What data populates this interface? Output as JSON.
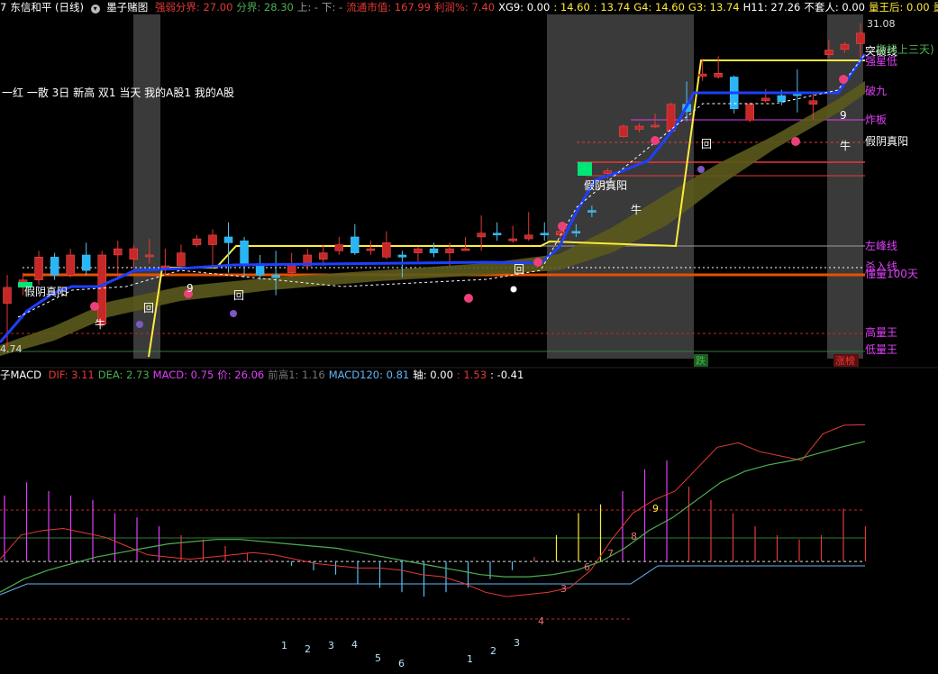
{
  "header": {
    "code": "7",
    "name": "东信和平 (日线)",
    "formula": "墨子赌图",
    "items": [
      {
        "label": "强弱分界:",
        "value": "27.00",
        "color": "#e53935"
      },
      {
        "label": "分界:",
        "value": "28.30",
        "color": "#4caf50"
      },
      {
        "label": "上:",
        "value": "-",
        "color": "#9e9e9e"
      },
      {
        "label": "下:",
        "value": "-",
        "color": "#9e9e9e"
      },
      {
        "label": "流通市值:",
        "value": "167.99",
        "color": "#e53935"
      },
      {
        "label": "利润%:",
        "value": "7.40",
        "color": "#e53935"
      },
      {
        "label": "XG9:",
        "value": "0.00",
        "color": "#ffffff"
      },
      {
        "label": ":",
        "value": "14.60",
        "color": "#ffeb3b"
      },
      {
        "label": ":",
        "value": "13.74",
        "color": "#ffeb3b"
      },
      {
        "label": "G4:",
        "value": "14.60",
        "color": "#ffeb3b"
      },
      {
        "label": "G3:",
        "value": "13.74",
        "color": "#ffeb3b"
      },
      {
        "label": "H11:",
        "value": "27.26",
        "color": "#ffffff"
      },
      {
        "label": "不套人:",
        "value": "0.00",
        "color": "#ffffff"
      },
      {
        "label": "量王后:",
        "value": "0.00",
        "color": "#ffeb3b"
      },
      {
        "label": "量",
        "value": "",
        "color": "#ffeb3b"
      }
    ]
  },
  "main_chart": {
    "price_high": "31.08",
    "price_low": "4.74",
    "legend_text": "一红 一散 3日 新高 双1 当天 我的A股1 我的A股",
    "right_labels": [
      {
        "text": "突破线",
        "color": "#ffffff"
      },
      {
        "text": "指标上三天)",
        "color": "#4caf50"
      },
      {
        "text": "强星低",
        "color": "#e040fb"
      },
      {
        "text": "破九",
        "color": "#e040fb"
      },
      {
        "text": "炸板",
        "color": "#e040fb"
      },
      {
        "text": "假阴真阳",
        "color": "#ffffff"
      },
      {
        "text": "左峰线",
        "color": "#e040fb"
      },
      {
        "text": "杀入线",
        "color": "#e040fb"
      },
      {
        "text": "懂量100天",
        "color": "#e040fb"
      },
      {
        "text": "高量王",
        "color": "#e040fb"
      },
      {
        "text": "低量王",
        "color": "#e040fb"
      }
    ],
    "annotations": [
      "假阴真阳",
      "假阴真阳",
      "回",
      "回",
      "回",
      "回",
      "牛",
      "牛",
      "牛",
      "9",
      "9",
      "9"
    ],
    "bottom_tags": [
      {
        "text": "跌",
        "color": "#4caf50"
      },
      {
        "text": "涨榜",
        "color": "#e53935"
      }
    ]
  },
  "macd_header": {
    "title": "子MACD",
    "items": [
      {
        "label": "DIF:",
        "value": "3.11",
        "color": "#e53935"
      },
      {
        "label": "DEA:",
        "value": "2.73",
        "color": "#4caf50"
      },
      {
        "label": "MACD:",
        "value": "0.75",
        "color": "#e040fb"
      },
      {
        "label": "价:",
        "value": "26.06",
        "color": "#e040fb"
      },
      {
        "label": "前高1:",
        "value": "1.16",
        "color": "#757575"
      },
      {
        "label": "MACD120:",
        "value": "0.81",
        "color": "#64b5f6"
      },
      {
        "label": "轴:",
        "value": "0.00",
        "color": "#ffffff"
      },
      {
        "label": ":",
        "value": "1.53",
        "color": "#e53935"
      },
      {
        "label": ":",
        "value": "-0.41",
        "color": "#ffffff"
      }
    ]
  },
  "macd_counts": {
    "up": [
      "3",
      "4",
      "5",
      "6",
      "7",
      "8",
      "9"
    ],
    "down": [
      "1",
      "2",
      "3",
      "4",
      "5",
      "6",
      "1",
      "2",
      "3"
    ]
  },
  "chart_data": {
    "type": "candlestick",
    "candles": [
      {
        "o": 6.3,
        "c": 6.9,
        "h": 7.4,
        "l": 4.9
      },
      {
        "o": 6.9,
        "c": 7.2,
        "h": 7.5,
        "l": 6.6
      },
      {
        "o": 7.2,
        "c": 8.2,
        "h": 8.5,
        "l": 7.0
      },
      {
        "o": 8.2,
        "c": 7.4,
        "h": 8.4,
        "l": 7.2
      },
      {
        "o": 7.4,
        "c": 8.3,
        "h": 8.6,
        "l": 7.3
      },
      {
        "o": 8.3,
        "c": 7.6,
        "h": 8.9,
        "l": 7.4
      },
      {
        "o": 5.6,
        "c": 8.3,
        "h": 8.5,
        "l": 5.5
      },
      {
        "o": 8.3,
        "c": 8.6,
        "h": 9.0,
        "l": 7.2
      },
      {
        "o": 8.1,
        "c": 8.6,
        "h": 8.8,
        "l": 7.7
      },
      {
        "o": 8.3,
        "c": 8.3,
        "h": 9.1,
        "l": 7.9
      },
      {
        "o": 7.8,
        "c": 7.8,
        "h": 8.6,
        "l": 7.4
      },
      {
        "o": 7.8,
        "c": 8.4,
        "h": 8.8,
        "l": 7.8
      },
      {
        "o": 8.8,
        "c": 9.1,
        "h": 9.3,
        "l": 8.7
      },
      {
        "o": 8.8,
        "c": 9.3,
        "h": 9.6,
        "l": 7.7
      },
      {
        "o": 9.2,
        "c": 8.9,
        "h": 10.0,
        "l": 7.5
      },
      {
        "o": 9.0,
        "c": 7.8,
        "h": 9.2,
        "l": 7.3
      },
      {
        "o": 7.9,
        "c": 7.4,
        "h": 8.3,
        "l": 7.2
      },
      {
        "o": 7.4,
        "c": 7.3,
        "h": 8.5,
        "l": 6.6
      },
      {
        "o": 7.5,
        "c": 7.9,
        "h": 8.4,
        "l": 7.3
      },
      {
        "o": 7.8,
        "c": 8.3,
        "h": 8.6,
        "l": 7.6
      },
      {
        "o": 8.1,
        "c": 8.4,
        "h": 8.8,
        "l": 7.8
      },
      {
        "o": 8.5,
        "c": 8.8,
        "h": 9.2,
        "l": 8.3
      },
      {
        "o": 9.2,
        "c": 8.4,
        "h": 9.9,
        "l": 8.3
      },
      {
        "o": 8.6,
        "c": 8.6,
        "h": 9.0,
        "l": 8.3
      },
      {
        "o": 8.2,
        "c": 8.9,
        "h": 9.5,
        "l": 8.1
      },
      {
        "o": 8.3,
        "c": 8.2,
        "h": 8.5,
        "l": 7.3
      },
      {
        "o": 8.4,
        "c": 8.6,
        "h": 8.7,
        "l": 8.0
      },
      {
        "o": 8.6,
        "c": 8.4,
        "h": 8.9,
        "l": 8.2
      },
      {
        "o": 8.4,
        "c": 8.6,
        "h": 8.9,
        "l": 7.8
      },
      {
        "o": 8.6,
        "c": 8.6,
        "h": 9.2,
        "l": 8.5
      },
      {
        "o": 9.2,
        "c": 9.4,
        "h": 10.4,
        "l": 8.5
      },
      {
        "o": 9.4,
        "c": 9.3,
        "h": 10.0,
        "l": 9.0
      },
      {
        "o": 9.0,
        "c": 9.1,
        "h": 9.8,
        "l": 8.9
      },
      {
        "o": 9.1,
        "c": 9.3,
        "h": 10.6,
        "l": 9.0
      },
      {
        "o": 9.4,
        "c": 9.3,
        "h": 10.0,
        "l": 9.0
      },
      {
        "o": 9.3,
        "c": 9.5,
        "h": 9.8,
        "l": 9.1
      },
      {
        "o": 9.5,
        "c": 9.4,
        "h": 9.9,
        "l": 9.2
      },
      {
        "o": 10.7,
        "c": 10.6,
        "h": 11.0,
        "l": 10.3
      },
      {
        "o": 13.2,
        "c": 13.4,
        "h": 13.6,
        "l": 12.8
      },
      {
        "o": 16.3,
        "c": 17.3,
        "h": 17.5,
        "l": 16.2
      },
      {
        "o": 17.0,
        "c": 17.3,
        "h": 17.6,
        "l": 16.7
      },
      {
        "o": 17.3,
        "c": 17.4,
        "h": 18.6,
        "l": 17.1
      },
      {
        "o": 16.8,
        "c": 19.6,
        "h": 19.8,
        "l": 16.6
      },
      {
        "o": 19.6,
        "c": 18.8,
        "h": 22.3,
        "l": 17.8
      },
      {
        "o": 23.0,
        "c": 23.3,
        "h": 25.4,
        "l": 22.4
      },
      {
        "o": 22.9,
        "c": 23.4,
        "h": 25.8,
        "l": 22.7
      },
      {
        "o": 22.9,
        "c": 19.1,
        "h": 23.1,
        "l": 18.6
      },
      {
        "o": 17.9,
        "c": 19.6,
        "h": 19.8,
        "l": 17.7
      },
      {
        "o": 20.0,
        "c": 20.3,
        "h": 21.4,
        "l": 19.8
      },
      {
        "o": 20.6,
        "c": 19.9,
        "h": 21.3,
        "l": 19.5
      },
      {
        "o": 20.8,
        "c": 20.7,
        "h": 23.9,
        "l": 18.7
      },
      {
        "o": 19.6,
        "c": 20.0,
        "h": 20.9,
        "l": 17.9
      },
      {
        "o": 26.0,
        "c": 26.7,
        "h": 28.3,
        "l": 25.5
      },
      {
        "o": 26.8,
        "c": 27.6,
        "h": 27.9,
        "l": 26.3
      },
      {
        "o": 27.7,
        "c": 29.4,
        "h": 31.1,
        "l": 24.9
      }
    ],
    "macd": {
      "dif": [
        0.05,
        0.6,
        0.7,
        0.75,
        0.65,
        0.55,
        0.35,
        0.15,
        0.1,
        0.05,
        0.1,
        0.15,
        0.2,
        0.15,
        0.05,
        -0.05,
        -0.1,
        -0.15,
        -0.15,
        -0.2,
        -0.3,
        -0.35,
        -0.5,
        -0.7,
        -0.8,
        -0.75,
        -0.7,
        -0.6,
        -0.2,
        0.5,
        1.1,
        1.4,
        1.6,
        2.1,
        2.6,
        2.7,
        2.5,
        2.4,
        2.3,
        2.9,
        3.1,
        3.11
      ],
      "dea": [
        -0.7,
        -0.4,
        -0.2,
        -0.05,
        0.1,
        0.2,
        0.3,
        0.4,
        0.45,
        0.5,
        0.5,
        0.45,
        0.4,
        0.35,
        0.3,
        0.2,
        0.1,
        0.0,
        -0.1,
        -0.2,
        -0.3,
        -0.35,
        -0.35,
        -0.3,
        -0.2,
        0.0,
        0.3,
        0.7,
        1.0,
        1.4,
        1.8,
        2.05,
        2.2,
        2.3,
        2.45,
        2.6,
        2.73
      ],
      "ylim": [
        -2.5,
        4.0
      ]
    }
  }
}
